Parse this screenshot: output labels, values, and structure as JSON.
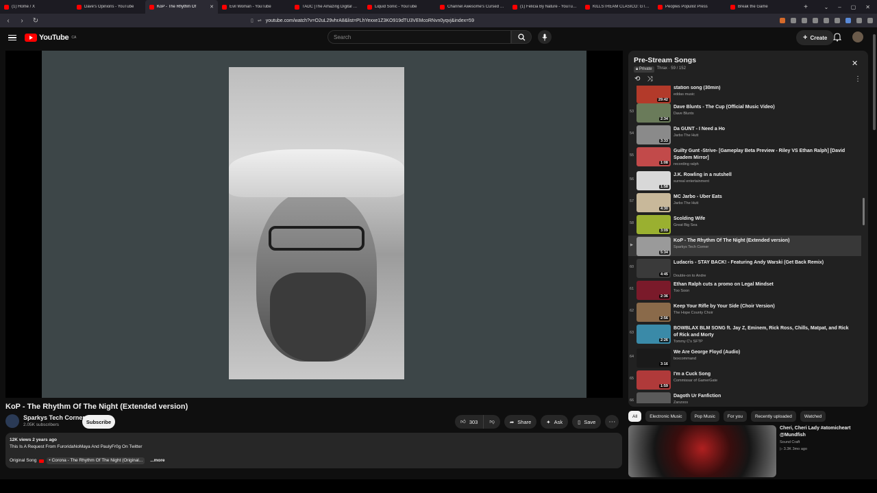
{
  "tabs": [
    {
      "label": "(1) Home / X",
      "active": false
    },
    {
      "label": "Dave's Opinions - YouTube",
      "active": false
    },
    {
      "label": "KoP - The Rhythm Of",
      "active": true
    },
    {
      "label": "Evil Woman - YouTube",
      "active": false
    },
    {
      "label": "TADC [The Amazing Digital C...",
      "active": false
    },
    {
      "label": "Liquid Sonic - YouTube",
      "active": false
    },
    {
      "label": "Channel Awesome's Cursed C...",
      "active": false
    },
    {
      "label": "(1) Felicia By Nature - YouTub...",
      "active": false
    },
    {
      "label": "KILLSTREAM CLÁSICO: GTA VI...",
      "active": false
    },
    {
      "label": "Peoples Populist Press",
      "active": false
    },
    {
      "label": "Break the Game",
      "active": false
    }
  ],
  "browser": {
    "url": "youtube.com/watch?v=O2uL29vhrA8&list=PLhYexxe1Z3KO919dTU3VEMcoRNvn0yqvj&index=59"
  },
  "header": {
    "logo_text": "YouTube",
    "region": "CA",
    "search_placeholder": "Search",
    "create_label": "Create"
  },
  "video": {
    "title": "KoP - The Rhythm Of The Night (Extended version)",
    "channel": "Sparkys Tech Corner",
    "subscribers": "2.05K subscribers",
    "subscribe_label": "Subscribe",
    "likes": "303",
    "share_label": "Share",
    "ask_label": "Ask",
    "save_label": "Save"
  },
  "description": {
    "meta": "12K views  2 years ago",
    "text": "This Is A Request From FuroridaNoMaya And PaulyFr0g On Twitter",
    "orig_label": "Original Song",
    "orig_link": "• Corona - The Rhythm Of The Night (Original...",
    "more": "...more"
  },
  "playlist": {
    "title": "Pre-Stream Songs",
    "privacy": "Private",
    "owner_progress": "Thrax · 59 / 152",
    "items": [
      {
        "idx": "",
        "title": "station song (30min)",
        "channel": "eddas music",
        "duration": "29:42",
        "color": "#b33a2a"
      },
      {
        "idx": "53",
        "title": "Dave Blunts - The Cup (Official Music Video)",
        "channel": "Dave Blunts",
        "duration": "2:34",
        "color": "#6a7b5a"
      },
      {
        "idx": "54",
        "title": "Da GUNT - I Need a Ho",
        "channel": "Jarbo The Hutt",
        "duration": "3:33",
        "color": "#8a8a8a"
      },
      {
        "idx": "55",
        "title": "Guilty Gunt -Strive- [Gameplay Beta Preview - Riley VS Ethan Ralph] [David Spadem Mirror]",
        "channel": "recording ralph",
        "duration": "1:08",
        "color": "#c24a4a"
      },
      {
        "idx": "56",
        "title": "J.K. Rowling in a nutshell",
        "channel": "surreal entertainment",
        "duration": "1:58",
        "color": "#d8d8d8"
      },
      {
        "idx": "57",
        "title": "MC Jarbo - Uber Eats",
        "channel": "Jarbo The Hutt",
        "duration": "4:30",
        "color": "#c8b89a"
      },
      {
        "idx": "58",
        "title": "Scolding Wife",
        "channel": "Great Big Sea",
        "duration": "3:09",
        "color": "#9ab030"
      },
      {
        "idx": "▶",
        "title": "KoP - The Rhythm Of The Night (Extended version)",
        "channel": "Sparkys Tech Corner",
        "duration": "5:34",
        "color": "#9a9a9a",
        "current": true
      },
      {
        "idx": "60",
        "title": "Ludacris - STAY BACK! - Featuring Andy Warski (Get Back Remix)",
        "channel": "Double-on to Andre",
        "duration": "4:45",
        "color": "#3a3a3a"
      },
      {
        "idx": "61",
        "title": "Ethan Ralph cuts a promo on Legal Mindset",
        "channel": "Too Soon",
        "duration": "2:36",
        "color": "#7a1a2a"
      },
      {
        "idx": "62",
        "title": "Keep Your Rifle by Your Side (Choir Version)",
        "channel": "The Hope County Choir",
        "duration": "2:56",
        "color": "#8a6a4a"
      },
      {
        "idx": "63",
        "title": "BOWBLAX BLM SONG ft. Jay Z, Eminem, Rick Ross, Chills, Matpat, and Rick of Rick and Morty",
        "channel": "Tommy C's SFTP",
        "duration": "2:26",
        "color": "#3a8aa8"
      },
      {
        "idx": "64",
        "title": "We Are George Floyd (Audio)",
        "channel": "boxcommand",
        "duration": "3:16",
        "color": "#1a1a1a"
      },
      {
        "idx": "65",
        "title": "I'm a Cuck Song",
        "channel": "Commissar of GamerGate",
        "duration": "1:59",
        "color": "#b03a3a"
      },
      {
        "idx": "66",
        "title": "Dagoth Ur Fanfiction",
        "channel": "Zanzoos",
        "duration": "",
        "color": "#5a5a5a"
      }
    ]
  },
  "chips": [
    "All",
    "Electronic Music",
    "Pop Music",
    "For you",
    "Recently uploaded",
    "Watched"
  ],
  "recommendation": {
    "title": "Cheri, Cheri Lady #atomicheart @Mundfish",
    "channel": "Sound Craft",
    "stats": "▷ 3.3K  3mo ago"
  }
}
